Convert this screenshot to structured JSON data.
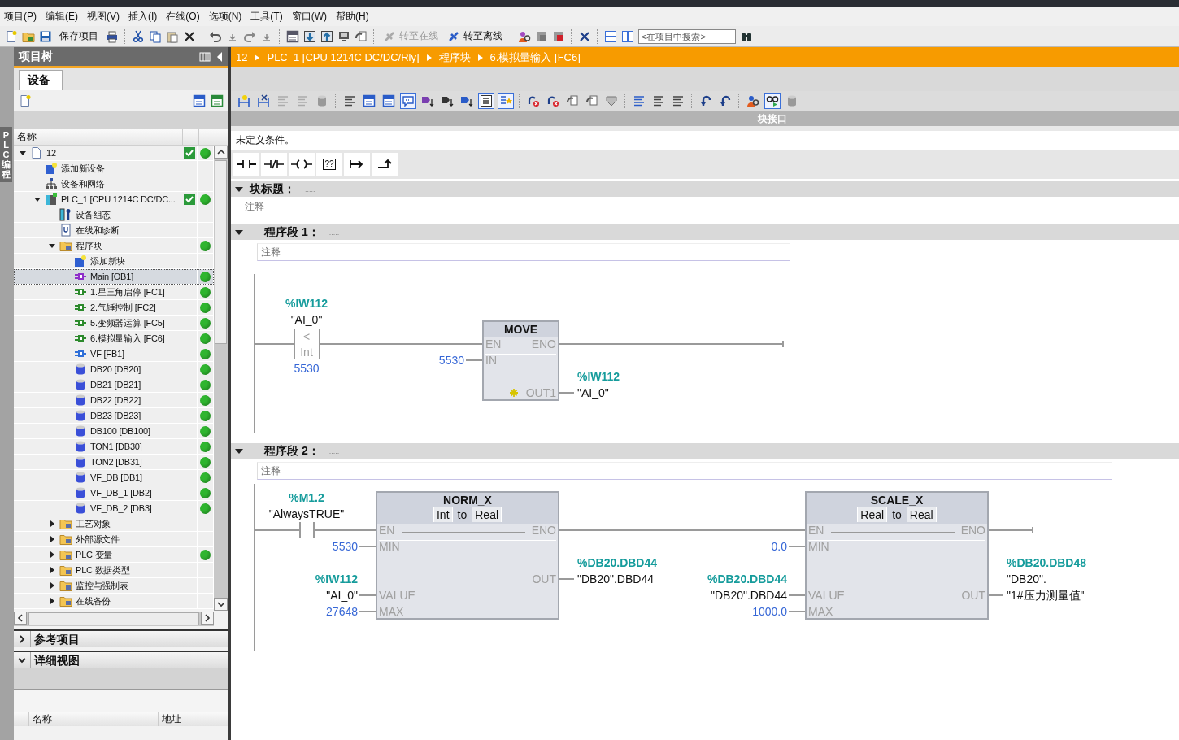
{
  "menu": [
    "项目(P)",
    "编辑(E)",
    "视图(V)",
    "插入(I)",
    "在线(O)",
    "选项(N)",
    "工具(T)",
    "窗口(W)",
    "帮助(H)"
  ],
  "toolbar": {
    "save_label": "保存项目",
    "go_online": {
      "label": "转至在线",
      "disabled": true
    },
    "go_offline": {
      "label": "转至离线",
      "disabled": false
    },
    "search_placeholder": "<在项目中搜索>"
  },
  "side_tab": "PLC 编程",
  "project_tree": {
    "title": "项目树",
    "tabs": [
      {
        "label": "设备",
        "selected": true
      }
    ],
    "column": "名称",
    "items": [
      {
        "label": "12",
        "kind": "project",
        "expanded": true,
        "selected": false,
        "checked": true,
        "online": true,
        "children": [
          {
            "label": "添加新设备",
            "kind": "add",
            "selected": false,
            "checked": false,
            "online": false
          },
          {
            "label": "设备和网络",
            "kind": "network",
            "selected": false,
            "checked": false,
            "online": false
          },
          {
            "label": "PLC_1 [CPU 1214C DC/DC...",
            "kind": "plc",
            "expanded": true,
            "selected": false,
            "checked": true,
            "online": true,
            "children": [
              {
                "label": "设备组态",
                "kind": "config",
                "selected": false,
                "checked": false,
                "online": false
              },
              {
                "label": "在线和诊断",
                "kind": "diag",
                "selected": false,
                "checked": false,
                "online": false
              },
              {
                "label": "程序块",
                "kind": "folder",
                "expanded": true,
                "selected": false,
                "checked": false,
                "online": true,
                "children": [
                  {
                    "label": "添加新块",
                    "kind": "add",
                    "selected": false,
                    "checked": false,
                    "online": false
                  },
                  {
                    "label": "Main [OB1]",
                    "kind": "ob",
                    "selected": true,
                    "checked": false,
                    "online": true
                  },
                  {
                    "label": "1.星三角启停 [FC1]",
                    "kind": "fc",
                    "selected": false,
                    "checked": false,
                    "online": true
                  },
                  {
                    "label": "2.气锤控制 [FC2]",
                    "kind": "fc",
                    "selected": false,
                    "checked": false,
                    "online": true
                  },
                  {
                    "label": "5.变频器运算 [FC5]",
                    "kind": "fc",
                    "selected": false,
                    "checked": false,
                    "online": true
                  },
                  {
                    "label": "6.模拟量输入 [FC6]",
                    "kind": "fc",
                    "selected": false,
                    "checked": false,
                    "online": true
                  },
                  {
                    "label": "VF [FB1]",
                    "kind": "fb",
                    "selected": false,
                    "checked": false,
                    "online": true
                  },
                  {
                    "label": "DB20 [DB20]",
                    "kind": "db",
                    "selected": false,
                    "checked": false,
                    "online": true
                  },
                  {
                    "label": "DB21 [DB21]",
                    "kind": "db",
                    "selected": false,
                    "checked": false,
                    "online": true
                  },
                  {
                    "label": "DB22 [DB22]",
                    "kind": "db",
                    "selected": false,
                    "checked": false,
                    "online": true
                  },
                  {
                    "label": "DB23 [DB23]",
                    "kind": "db",
                    "selected": false,
                    "checked": false,
                    "online": true
                  },
                  {
                    "label": "DB100 [DB100]",
                    "kind": "db",
                    "selected": false,
                    "checked": false,
                    "online": true
                  },
                  {
                    "label": "TON1 [DB30]",
                    "kind": "db",
                    "selected": false,
                    "checked": false,
                    "online": true
                  },
                  {
                    "label": "TON2 [DB31]",
                    "kind": "db",
                    "selected": false,
                    "checked": false,
                    "online": true
                  },
                  {
                    "label": "VF_DB [DB1]",
                    "kind": "db",
                    "selected": false,
                    "checked": false,
                    "online": true
                  },
                  {
                    "label": "VF_DB_1 [DB2]",
                    "kind": "db",
                    "selected": false,
                    "checked": false,
                    "online": true
                  },
                  {
                    "label": "VF_DB_2 [DB3]",
                    "kind": "db",
                    "selected": false,
                    "checked": false,
                    "online": true
                  }
                ]
              },
              {
                "label": "工艺对象",
                "kind": "folder",
                "expanded": false,
                "selected": false,
                "checked": false,
                "online": false
              },
              {
                "label": "外部源文件",
                "kind": "folder",
                "expanded": false,
                "selected": false,
                "checked": false,
                "online": false
              },
              {
                "label": "PLC 变量",
                "kind": "folder",
                "expanded": false,
                "selected": false,
                "checked": false,
                "online": true
              },
              {
                "label": "PLC 数据类型",
                "kind": "folder",
                "expanded": false,
                "selected": false,
                "checked": false,
                "online": false
              },
              {
                "label": "监控与强制表",
                "kind": "folder",
                "expanded": false,
                "selected": false,
                "checked": false,
                "online": false
              },
              {
                "label": "在线备份",
                "kind": "folder",
                "expanded": false,
                "selected": false,
                "checked": false,
                "online": false
              }
            ]
          }
        ]
      }
    ]
  },
  "panels": [
    {
      "label": "参考项目",
      "expanded": false
    },
    {
      "label": "详细视图",
      "expanded": true,
      "columns": [
        "名称",
        "地址"
      ]
    }
  ],
  "editor": {
    "breadcrumb": [
      "12",
      "PLC_1 [CPU 1214C DC/DC/Rly]",
      "程序块",
      "6.模拟量输入 [FC6]"
    ],
    "toolbar": [
      {
        "selected": false
      },
      {
        "selected": false
      },
      {
        "selected": false
      },
      {
        "selected": false
      },
      {
        "selected": false
      },
      {
        "selected": false
      },
      {
        "selected": false
      },
      {
        "selected": false
      },
      {
        "selected": true
      },
      {
        "selected": false
      },
      {
        "selected": false
      },
      {
        "selected": false
      },
      {
        "selected": true
      },
      {
        "selected": true
      },
      {
        "selected": false
      },
      {
        "selected": false
      },
      {
        "selected": false
      },
      {
        "selected": false
      },
      {
        "selected": false
      },
      {
        "selected": false
      },
      {
        "selected": false
      },
      {
        "selected": false
      },
      {
        "selected": false
      },
      {
        "selected": false
      },
      {
        "selected": false
      },
      {
        "selected": true
      },
      {
        "selected": false
      }
    ],
    "interface_label": "块接口",
    "condition": "未定义条件。",
    "favorites": [
      {
        "kind": "no_contact"
      },
      {
        "kind": "nc_contact"
      },
      {
        "kind": "coil"
      },
      {
        "kind": "empty_box",
        "label": "??"
      },
      {
        "kind": "open_branch"
      },
      {
        "kind": "close_branch"
      }
    ],
    "block_title": {
      "label": "块标题：",
      "title_comment": ".....",
      "comment": "注释",
      "expanded": true
    },
    "networks": [
      {
        "title": "程序段 1：",
        "title_comment": ".....",
        "comment": "注释",
        "expanded": true,
        "contact": {
          "kind": "compare",
          "address": "%IW112",
          "tag": "\"AI_0\"",
          "operator": "<",
          "type": "Int",
          "operand": "5530"
        },
        "boxes": [
          {
            "name": "MOVE",
            "left": [
              {
                "pin": "EN"
              },
              {
                "pin": "IN",
                "value": "5530"
              }
            ],
            "right": [
              {
                "pin": "ENO",
                "marked": false
              },
              {
                "pin": "OUT1",
                "marked": true,
                "address": "%IW112",
                "tag": [
                  "\"AI_0\""
                ]
              }
            ]
          }
        ]
      },
      {
        "title": "程序段 2：",
        "title_comment": ".....",
        "comment": "注释",
        "expanded": true,
        "contact": {
          "kind": "no",
          "address": "%M1.2",
          "tag": "\"AlwaysTRUE\""
        },
        "boxes": [
          {
            "name": "NORM_X",
            "types": [
              "Int",
              "to",
              "Real"
            ],
            "left": [
              {
                "pin": "EN"
              },
              {
                "pin": "MIN",
                "value": "5530"
              },
              {
                "pin": "VALUE",
                "address": "%IW112",
                "tag": [
                  "\"AI_0\""
                ]
              },
              {
                "pin": "MAX",
                "value": "27648"
              }
            ],
            "right": [
              {
                "pin": "ENO",
                "marked": false
              },
              {
                "pin": "OUT",
                "marked": false,
                "address": "%DB20.DBD44",
                "tag": [
                  "\"DB20\".DBD44"
                ]
              }
            ]
          },
          {
            "name": "SCALE_X",
            "types": [
              "Real",
              "to",
              "Real"
            ],
            "left": [
              {
                "pin": "EN"
              },
              {
                "pin": "MIN",
                "value": "0.0"
              },
              {
                "pin": "VALUE",
                "address": "%DB20.DBD44",
                "tag": [
                  "\"DB20\".DBD44"
                ]
              },
              {
                "pin": "MAX",
                "value": "1000.0"
              }
            ],
            "right": [
              {
                "pin": "ENO",
                "marked": false
              },
              {
                "pin": "OUT",
                "marked": false,
                "address": "%DB20.DBD48",
                "tag": [
                  "\"DB20\".",
                  "\"1#压力测量值\""
                ]
              }
            ]
          }
        ]
      }
    ]
  }
}
